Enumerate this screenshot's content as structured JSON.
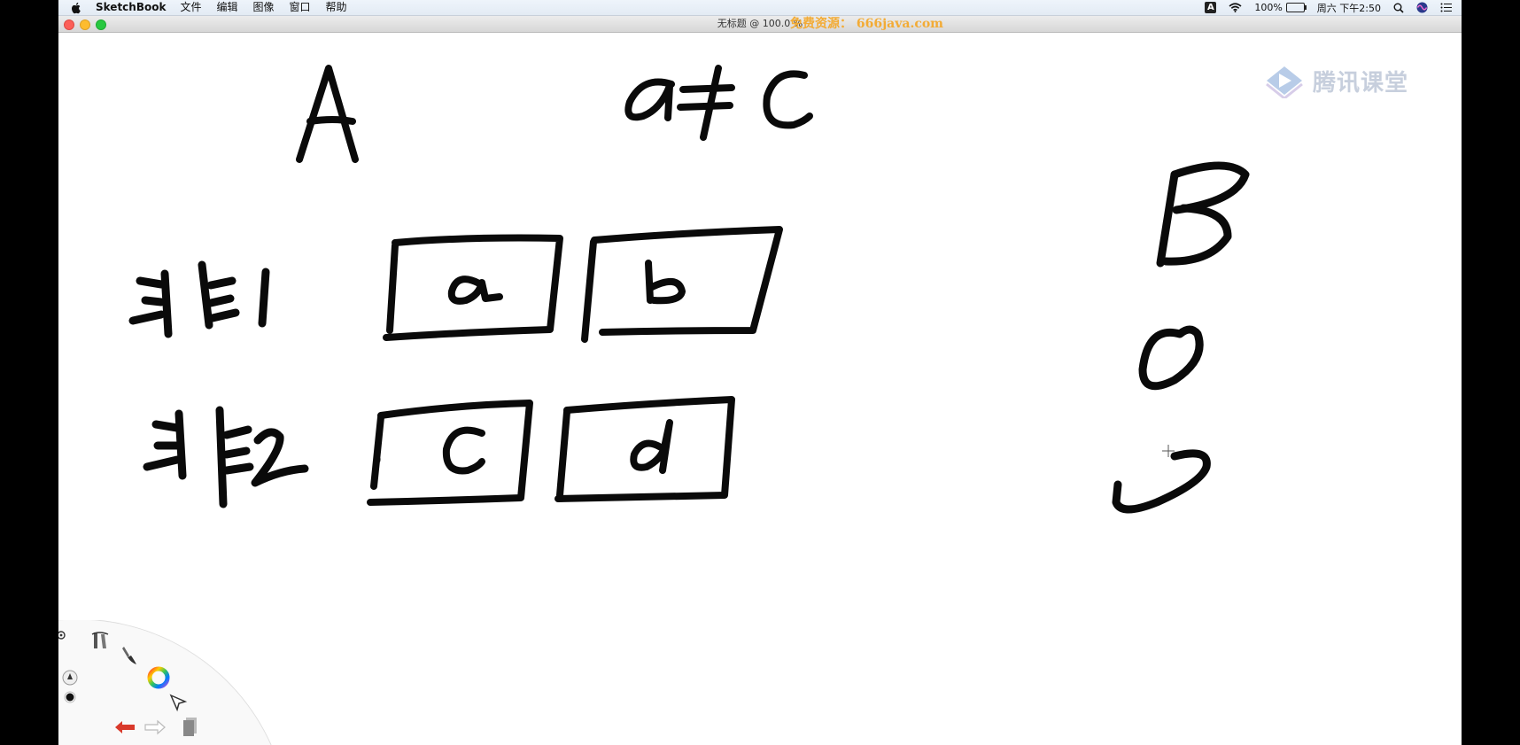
{
  "menubar": {
    "app_name": "SketchBook",
    "items": [
      "文件",
      "编辑",
      "图像",
      "窗口",
      "帮助"
    ],
    "input_method": "A",
    "battery": "100%",
    "clock": "周六 下午2:50"
  },
  "window": {
    "title": "无标题 @ 100.0 %",
    "watermark": "免费资源： 666java.com"
  },
  "brand": {
    "name": "腾讯课堂"
  },
  "canvas": {
    "handwriting": [
      "A",
      "a≠C",
      "非1",
      "a",
      "b",
      "非2",
      "c",
      "d",
      "B",
      "0",
      "J"
    ]
  },
  "colors": {
    "ink": "#0a0a0a",
    "canvas_bg": "#ffffff",
    "watermark": "#f5a623",
    "brand": "#9aa9c2",
    "undo_arrow": "#d9392b"
  },
  "toolbar": {
    "tools": [
      "settings-icon",
      "ruler-icon",
      "brush-icon",
      "color-wheel-icon",
      "brush-puck-icon",
      "color-dot-icon",
      "select-icon",
      "undo-icon",
      "redo-icon",
      "layers-icon"
    ]
  }
}
